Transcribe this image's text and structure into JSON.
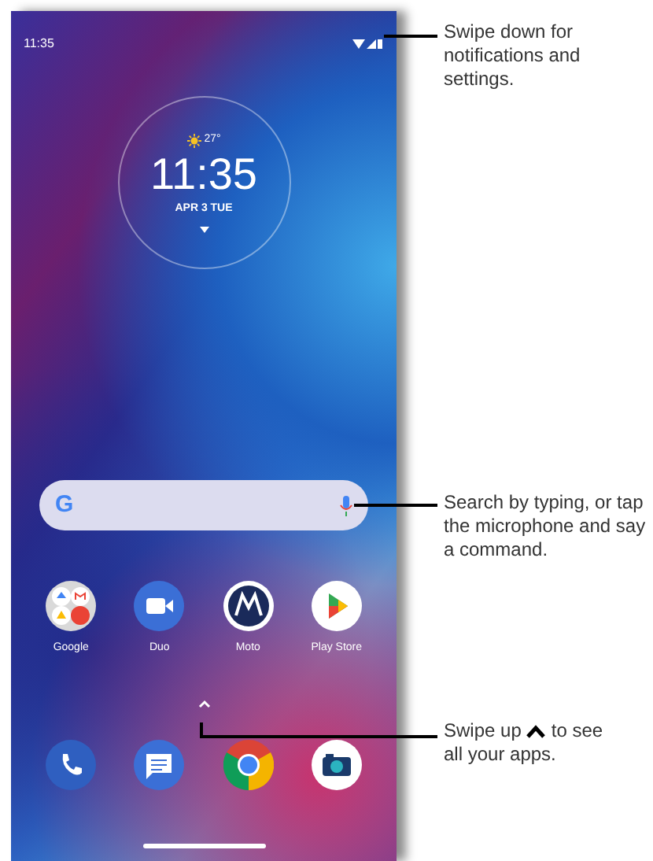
{
  "status_bar": {
    "time": "11:35"
  },
  "clock_widget": {
    "temperature": "27°",
    "time": "11:35",
    "date": "APR 3 TUE"
  },
  "search_bar": {
    "logo": "G"
  },
  "apps": [
    {
      "label": "Google",
      "kind": "folder"
    },
    {
      "label": "Duo",
      "kind": "duo"
    },
    {
      "label": "Moto",
      "kind": "moto"
    },
    {
      "label": "Play Store",
      "kind": "play"
    }
  ],
  "dock": [
    {
      "kind": "phone"
    },
    {
      "kind": "messages"
    },
    {
      "kind": "chrome"
    },
    {
      "kind": "camera"
    }
  ],
  "callouts": [
    {
      "text": "Swipe down for notifications and settings."
    },
    {
      "text": "Search by typing, or tap the microphone and say a command."
    },
    {
      "before": "Swipe up",
      "after": "to see",
      "continued": "all your apps."
    }
  ]
}
